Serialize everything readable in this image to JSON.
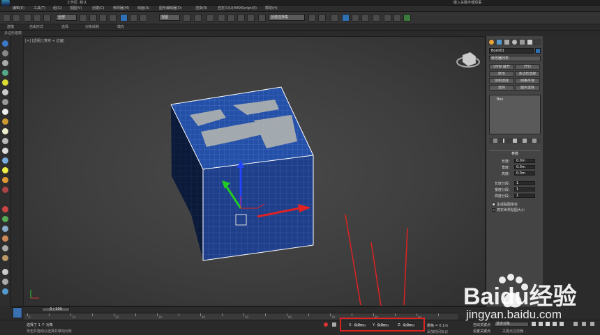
{
  "titlebar": {
    "left_text": "工作区: 默认",
    "right_text": "键入关键字或短语"
  },
  "menubar": {
    "items": [
      "编辑(E)",
      "工具(T)",
      "组(G)",
      "视图(V)",
      "创建(C)",
      "修改器(M)",
      "动画(A)",
      "图形编辑器(D)",
      "渲染(R)",
      "自定义(U)",
      "MAXScript(X)",
      "帮助(H)"
    ]
  },
  "toolbar": {
    "filter_label": "全部",
    "view_label": "视图",
    "named_set": "创建选择集"
  },
  "ribbon": {
    "items": [
      "建模",
      "自由形式",
      "选择",
      "对象绘制",
      "填充"
    ]
  },
  "subribbon": {
    "label": "多边形建模"
  },
  "viewport": {
    "label": "[+] [透视] [真实 + 边面]"
  },
  "rightpanel": {
    "object_name": "Box001",
    "modifier_list": "修改器列表",
    "buttons": [
      "UVW 展开",
      "FFD",
      "挤出",
      "多边形选择",
      "体积选择",
      "网格平滑",
      "选择",
      "面片选择"
    ],
    "stack_item": "Box",
    "params_title": "参数",
    "params": [
      {
        "label": "长度:",
        "value": "0.0m"
      },
      {
        "label": "宽度:",
        "value": "0.0m"
      },
      {
        "label": "高度:",
        "value": "0.0m"
      },
      {
        "label": "长度分段:",
        "value": "1"
      },
      {
        "label": "宽度分段:",
        "value": "1"
      },
      {
        "label": "高度分段:",
        "value": "1"
      }
    ],
    "checkbox1": "生成贴图坐标",
    "checkbox2": "真实世界贴图大小"
  },
  "timeline": {
    "frame": "0 / 100",
    "ticks": [
      "0",
      "5",
      "10",
      "15",
      "20",
      "25",
      "30",
      "35",
      "40",
      "45",
      "50",
      "55",
      "60",
      "65",
      "70",
      "75",
      "80",
      "85",
      "90",
      "95",
      "100"
    ]
  },
  "status": {
    "msg1": "选择了 1 个 对象",
    "msg2": "单击并拖动以选择并移动对象",
    "x_label": "X:",
    "x_value": "0.0m",
    "y_label": "Y:",
    "y_value": "0.0m",
    "z_label": "Z:",
    "z_value": "0.0m",
    "grid": "栅格 = 0.1m",
    "auto_key": "自动关键点",
    "set_key": "设置关键点",
    "selected": "选定对象",
    "key_filter": "关键点过滤器...",
    "add_time": "添加时间标记"
  },
  "watermark": {
    "brand": "Baidu经验",
    "url": "jingyan.baidu.com"
  },
  "colors": {
    "accent": "#2f6fb3",
    "highlight": "#dd2222",
    "cube": "#1f3f8a"
  }
}
